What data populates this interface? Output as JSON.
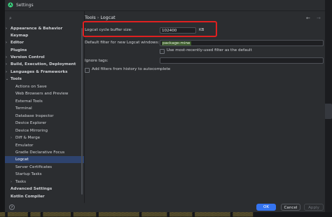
{
  "window": {
    "title": "Settings"
  },
  "search": {
    "icon": "search-icon"
  },
  "tree": {
    "items": [
      {
        "label": "Appearance & Behavior",
        "chev": "›",
        "bold": true
      },
      {
        "label": "Keymap",
        "chev": "",
        "bold": true
      },
      {
        "label": "Editor",
        "chev": "›",
        "bold": true
      },
      {
        "label": "Plugins",
        "chev": "",
        "bold": true
      },
      {
        "label": "Version Control",
        "chev": "›",
        "bold": true
      },
      {
        "label": "Build, Execution, Deployment",
        "chev": "›",
        "bold": true
      },
      {
        "label": "Languages & Frameworks",
        "chev": "›",
        "bold": true
      },
      {
        "label": "Tools",
        "chev": "⌄",
        "bold": true
      },
      {
        "label": "Actions on Save",
        "chev": ""
      },
      {
        "label": "Web Browsers and Preview",
        "chev": ""
      },
      {
        "label": "External Tools",
        "chev": ""
      },
      {
        "label": "Terminal",
        "chev": ""
      },
      {
        "label": "Database Inspector",
        "chev": ""
      },
      {
        "label": "Device Explorer",
        "chev": ""
      },
      {
        "label": "Device Mirroring",
        "chev": ""
      },
      {
        "label": "Diff & Merge",
        "chev": "›"
      },
      {
        "label": "Emulator",
        "chev": ""
      },
      {
        "label": "Gradle Declarative Focus",
        "chev": ""
      },
      {
        "label": "Logcat",
        "chev": "",
        "selected": true
      },
      {
        "label": "Server Certificates",
        "chev": ""
      },
      {
        "label": "Startup Tasks",
        "chev": ""
      },
      {
        "label": "Tasks",
        "chev": "›"
      },
      {
        "label": "Advanced Settings",
        "chev": "",
        "bold": true
      },
      {
        "label": "Kotlin Compiler",
        "chev": "",
        "bold": true
      }
    ]
  },
  "breadcrumb": {
    "parent": "Tools",
    "separator": "›",
    "current": "Logcat"
  },
  "nav": {
    "back": "←",
    "forward": "→"
  },
  "form": {
    "buffer_label": "Logcat cycle buffer size:",
    "buffer_value": "102400",
    "buffer_unit": "KB",
    "filter_label": "Default filter for new Logcat windows:",
    "filter_value": "package:mine",
    "mru_label": "Use most-recently-used filter as the default",
    "ignore_label": "Ignore tags:",
    "history_label": "Add filters from history to autocomplete"
  },
  "buttons": {
    "help": "?",
    "ok": "OK",
    "cancel": "Cancel",
    "apply": "Apply"
  },
  "bottom_text": "▒▒ ▒▒▒▒▒▒▒▒ ▒▒▒▒ ▒▒▒▒▒▒▒▒▒▒▒ ▒▒▒▒▒▒▒▒▒ ▒▒▒▒▒▒▒▒▒▒▒▒▒▒▒▒ ▒▒▒▒▒▒▒▒▒▒ ▒▒▒▒▒▒▒▒▒ ▒▒▒▒▒▒▒▒▒▒▒▒▒▒ ▒▒▒▒▒▒▒▒",
  "colors": {
    "accent": "#3574f0",
    "highlight_box": "#e02020",
    "selected_row": "#2e436e"
  }
}
